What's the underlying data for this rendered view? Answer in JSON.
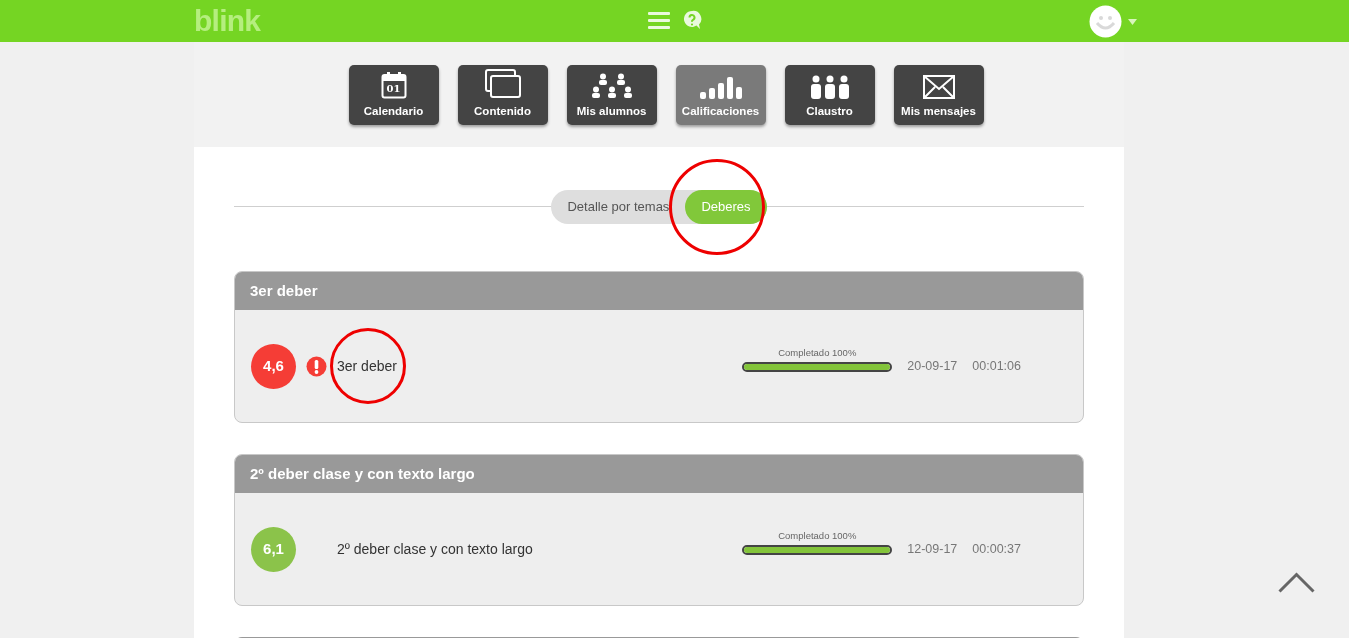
{
  "header": {
    "logo": "blink"
  },
  "nav": [
    {
      "label": "Calendario",
      "selected": false,
      "calendar_day": "01"
    },
    {
      "label": "Contenido",
      "selected": false
    },
    {
      "label": "Mis alumnos",
      "selected": false
    },
    {
      "label": "Calificaciones",
      "selected": true
    },
    {
      "label": "Claustro",
      "selected": false
    },
    {
      "label": "Mis mensajes",
      "selected": false
    }
  ],
  "tabs": [
    {
      "label": "Detalle por temas",
      "selected": false,
      "circled": false
    },
    {
      "label": "Deberes",
      "selected": true,
      "circled": true
    }
  ],
  "homework": [
    {
      "title": "3er deber",
      "score": "4,6",
      "passed": false,
      "warning": true,
      "name": "3er deber",
      "name_circled": true,
      "progress_label": "Completado 100%",
      "level": 1,
      "date": "20-09-17",
      "time": "00:01:06"
    },
    {
      "title": "2º deber clase y con texto largo",
      "score": "6,1",
      "passed": true,
      "warning": false,
      "name": "2º deber clase y con texto largo",
      "name_circled": false,
      "progress_label": "Completado 100%",
      "level": 1,
      "date": "12-09-17",
      "time": "00:00:37"
    }
  ]
}
